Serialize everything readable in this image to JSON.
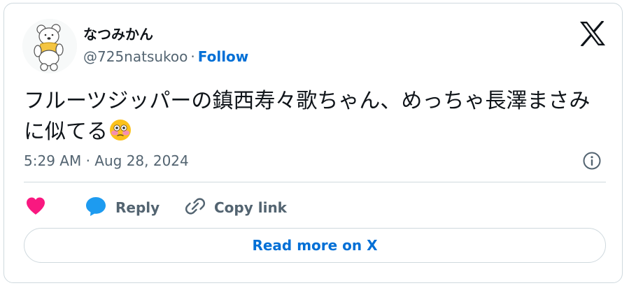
{
  "author": {
    "display_name": "なつみかん",
    "handle": "@725natsukoo",
    "separator": "·",
    "follow_label": "Follow"
  },
  "tweet": {
    "text": "フルーツジッパーの鎮西寿々歌ちゃん、めっちゃ長澤まさみに似てる",
    "emoji": "flushed-face-icon",
    "timestamp": "5:29 AM · Aug 28, 2024"
  },
  "actions": {
    "like_icon": "heart-icon",
    "reply_label": "Reply",
    "copy_label": "Copy link"
  },
  "read_more_label": "Read more on X",
  "colors": {
    "accent": "#006fd6",
    "like": "#f91880",
    "reply_icon": "#1d9bf0",
    "muted": "#536471",
    "border": "#cfd9de",
    "text": "#0f1419"
  }
}
